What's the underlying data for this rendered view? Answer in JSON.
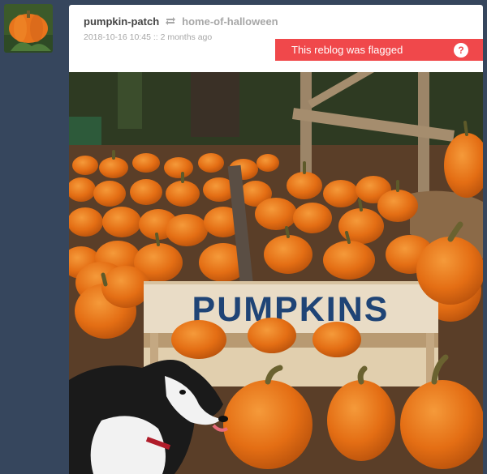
{
  "post": {
    "author": "pumpkin-patch",
    "reblog_source": "home-of-halloween",
    "timestamp": "2018-10-16 10:45",
    "relative_time": "2 months ago",
    "separator": "::"
  },
  "flag": {
    "message": "This reblog was flagged",
    "help_label": "?"
  },
  "photo": {
    "sign_text": "PUMPKINS"
  },
  "colors": {
    "background": "#36465d",
    "flag_red": "#f0484b",
    "pumpkin_orange": "#e8741c"
  },
  "icons": {
    "reblog": "reblog-icon",
    "help": "help-icon"
  }
}
